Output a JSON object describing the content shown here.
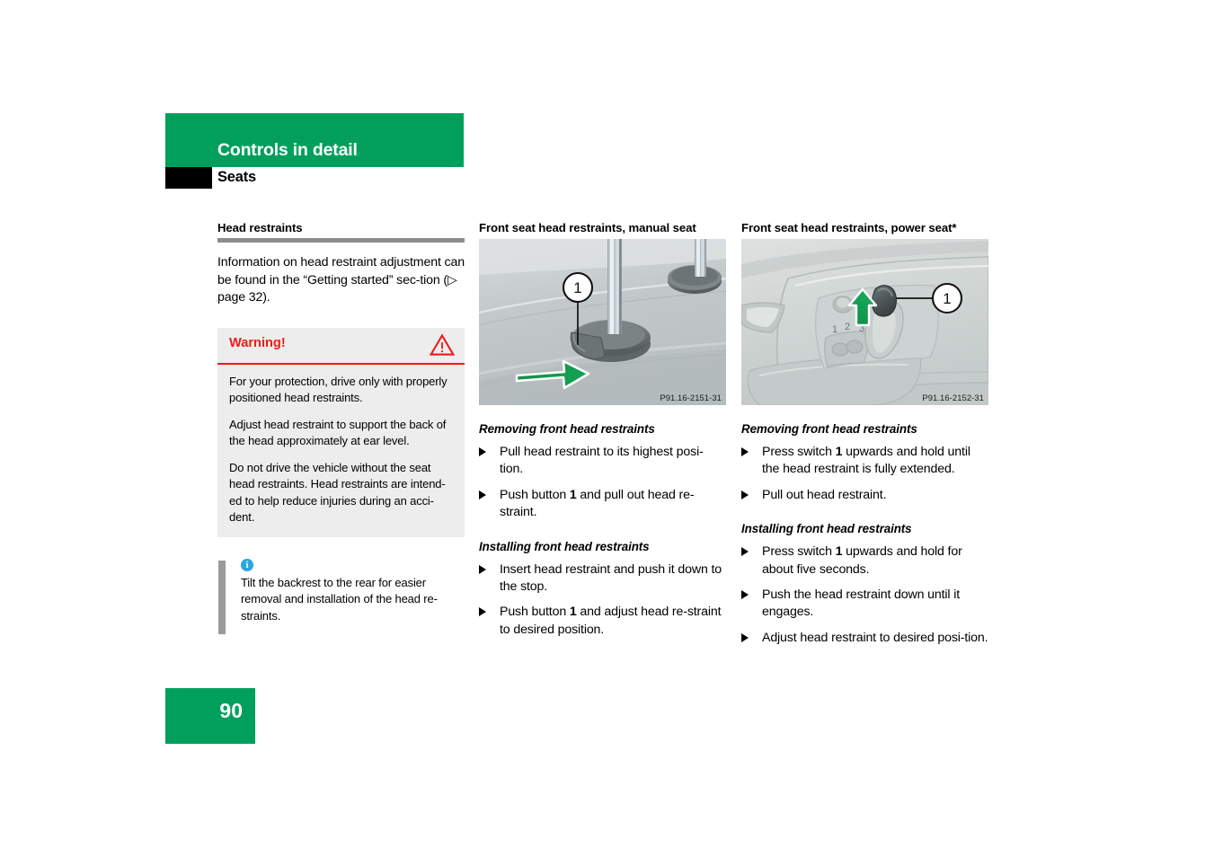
{
  "header": {
    "chapter": "Controls in detail",
    "section": "Seats"
  },
  "footer": {
    "page_number": "90"
  },
  "colors": {
    "brand_green": "#00a05c",
    "warning_red": "#ee1c17",
    "warning_bg": "#ededed",
    "info_blue": "#2ba6de",
    "rule_gray": "#8c8c8c"
  },
  "left_column": {
    "heading": "Head restraints",
    "intro": "Information on head restraint adjustment can be found in the “Getting started” sec-tion (▷ page 32).",
    "warning": {
      "label": "Warning!",
      "icon": "warning-triangle-icon",
      "paragraphs": [
        "For your protection, drive only with properly positioned head restraints.",
        "Adjust head restraint to support the back of the head approximately at ear level.",
        "Do not drive the vehicle without the seat head restraints. Head restraints are intend-ed to help reduce injuries during an acci-dent."
      ]
    },
    "info_note": {
      "icon": "info-circle-icon",
      "icon_glyph": "i",
      "text": "Tilt the backrest to the rear for easier removal and installation of the head re-straints."
    }
  },
  "middle_column": {
    "heading": "Front seat head restraints, manual seat",
    "figure": {
      "name": "manual-seat-head-restraint-figure",
      "callout": "1",
      "id_code": "P91.16-2151-31"
    },
    "removing": {
      "heading": "Removing front head restraints",
      "steps": [
        {
          "pre": "Pull head restraint to its highest posi-tion.",
          "ref": "",
          "post": ""
        },
        {
          "pre": "Push button ",
          "ref": "1",
          "post": " and pull out head re-straint."
        }
      ]
    },
    "installing": {
      "heading": "Installing front head restraints",
      "steps": [
        {
          "pre": "Insert head restraint and push it down to the stop.",
          "ref": "",
          "post": ""
        },
        {
          "pre": "Push button ",
          "ref": "1",
          "post": " and adjust head re-straint to desired position."
        }
      ]
    }
  },
  "right_column": {
    "heading": "Front seat head restraints, power seat*",
    "figure": {
      "name": "power-seat-head-restraint-figure",
      "callout": "1",
      "id_code": "P91.16-2152-31",
      "memory_buttons": [
        "1",
        "2",
        "3"
      ]
    },
    "removing": {
      "heading": "Removing front head restraints",
      "steps": [
        {
          "pre": "Press switch ",
          "ref": "1",
          "post": " upwards and hold until the head restraint is fully extended."
        },
        {
          "pre": "Pull out head restraint.",
          "ref": "",
          "post": ""
        }
      ]
    },
    "installing": {
      "heading": "Installing front head restraints",
      "steps": [
        {
          "pre": "Press switch ",
          "ref": "1",
          "post": " upwards and hold for about five seconds."
        },
        {
          "pre": "Push the head restraint down until it engages.",
          "ref": "",
          "post": ""
        },
        {
          "pre": "Adjust head restraint to desired posi-tion.",
          "ref": "",
          "post": ""
        }
      ]
    }
  }
}
